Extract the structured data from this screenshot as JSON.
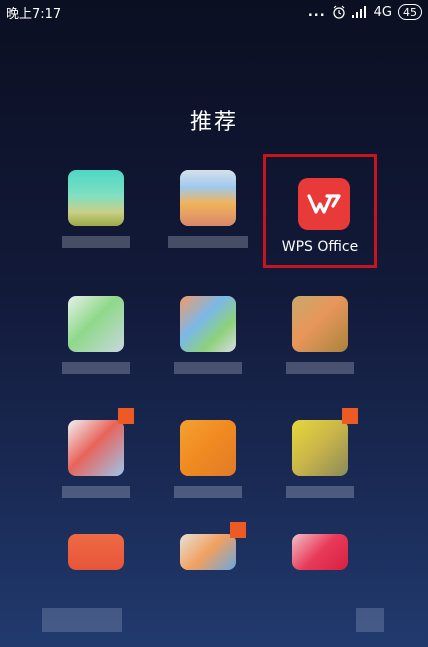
{
  "status_bar": {
    "time": "晚上7:17",
    "more_dots": "...",
    "network": "4G",
    "battery": "45"
  },
  "section_title": "推荐",
  "featured_app": {
    "label": "WPS Office",
    "icon": "wps-office-icon",
    "highlight_color": "#c8141c",
    "icon_color": "#e93a3a"
  },
  "colors": {
    "background_top": "#0b0f22",
    "background_bottom": "#213a6e",
    "badge": "#ee5a24"
  }
}
